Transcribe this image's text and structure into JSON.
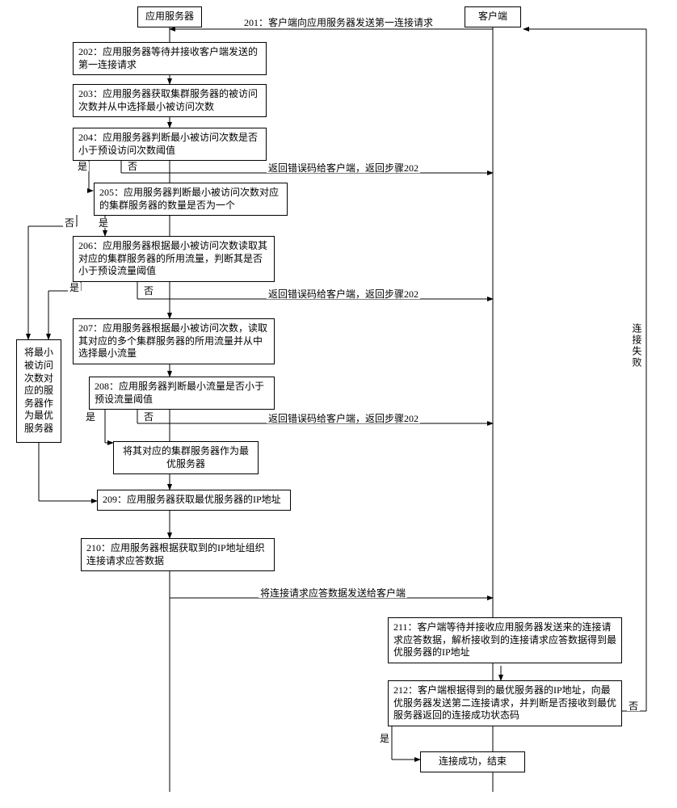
{
  "lane_server": "应用服务器",
  "lane_client": "客户端",
  "msg201": "201：客户端向应用服务器发送第一连接请求",
  "step202": "202：应用服务器等待并接收客户端发送的第一连接请求",
  "step203": "203：应用服务器获取集群服务器的被访问次数并从中选择最小被访问次数",
  "step204": "204：应用服务器判断最小被访问次数是否小于预设访问次数阈值",
  "ret204": "返回错误码给客户端，返回步骤202",
  "step205": "205：应用服务器判断最小被访问次数对应的集群服务器的数量是否为一个",
  "step206": "206：应用服务器根据最小被访问次数读取其对应的集群服务器的所用流量，判断其是否小于预设流量阈值",
  "ret206": "返回错误码给客户端，返回步骤202",
  "step207": "207：应用服务器根据最小被访问次数，读取其对应的多个集群服务器的所用流量并从中选择最小流量",
  "step208": "208：应用服务器判断最小流量是否小于预设流量阈值",
  "ret208": "返回错误码给客户端，返回步骤202",
  "opt_server": "将其对应的集群服务器作为最优服务器",
  "side_opt": "将最小被访问次数对应的服务器作为最优服务器",
  "step209": "209：应用服务器获取最优服务器的IP地址",
  "step210": "210：应用服务器根据获取到的IP地址组织连接请求应答数据",
  "msg_send_resp": "将连接请求应答数据发送给客户端",
  "step211": "211：客户端等待并接收应用服务器发送来的连接请求应答数据，解析接收到的连接请求应答数据得到最优服务器的IP地址",
  "step212": "212：客户端根据得到的最优服务器的IP地址，向最优服务器发送第二连接请求，并判断是否接收到最优服务器返回的连接成功状态码",
  "success": "连接成功，结束",
  "fail_label": "连接失败",
  "yes": "是",
  "no": "否"
}
